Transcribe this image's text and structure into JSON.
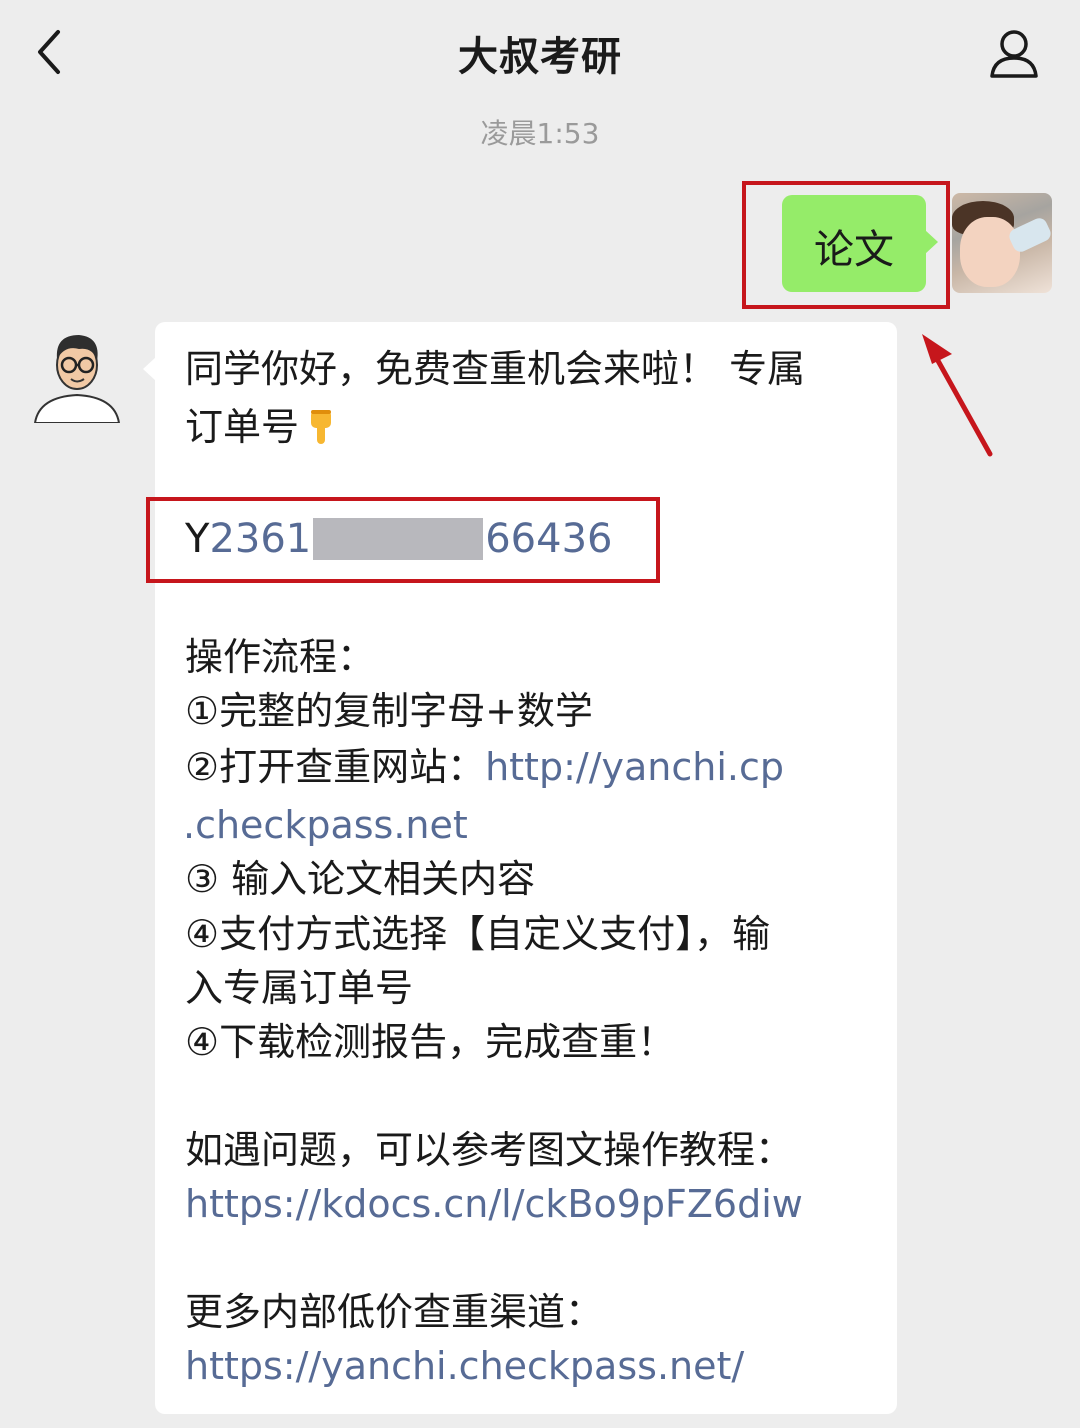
{
  "header": {
    "title": "大叔考研",
    "back_icon": "chevron-left-icon",
    "profile_icon": "person-icon"
  },
  "timestamp": "凌晨1:53",
  "outgoing": {
    "text": "论文"
  },
  "incoming": {
    "greeting_line1": "同学你好，免费查重机会来啦！ 专属",
    "greeting_line2": "订单号",
    "order_prefix": "Y",
    "order_start": "2361",
    "order_end": "66436",
    "steps_title": "操作流程：",
    "step1": "①完整的复制字母+数学",
    "step2_text": "②打开查重网站：",
    "step2_link_a": "http://yanchi.cp",
    "step2_link_b": ".checkpass.net",
    "step3": "③ 输入论文相关内容",
    "step4a_line1": "④支付方式选择【自定义支付】，输",
    "step4a_line2": "入专属订单号",
    "step4b": "④下载检测报告，完成查重！",
    "help_text": "如遇问题，可以参考图文操作教程：",
    "help_link": "https://kdocs.cn/l/ckBo9pFZ6diw",
    "more_text": "更多内部低价查重渠道：",
    "more_link": "https://yanchi.checkpass.net/"
  },
  "colors": {
    "bubble_out": "#95ec69",
    "link": "#576b95",
    "highlight": "#c6161c",
    "background": "#ededed"
  }
}
